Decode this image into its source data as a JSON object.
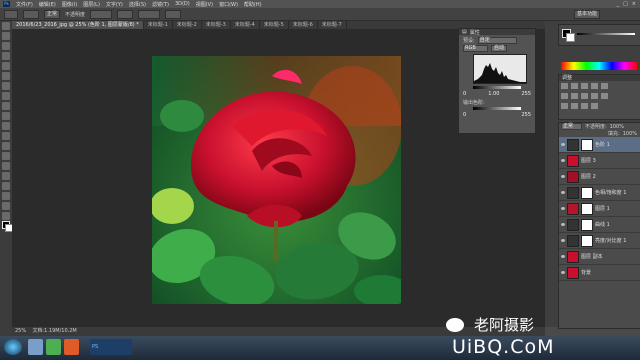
{
  "app": {
    "logo": "Ps",
    "window_controls": [
      "_",
      "□",
      "×"
    ]
  },
  "menu": [
    "文件(F)",
    "编辑(E)",
    "图像(I)",
    "图层(L)",
    "文字(Y)",
    "选择(S)",
    "滤镜(T)",
    "3D(D)",
    "视图(V)",
    "窗口(W)",
    "帮助(H)"
  ],
  "options": {
    "mode_label": "正常",
    "opacity_label": "不透明度",
    "workspace": "基本功能"
  },
  "tabs": [
    {
      "label": "2016/6/23_2016_jpg @ 25% (色阶 1, 图层蒙版/8) *",
      "active": true
    },
    {
      "label": "未标题-1",
      "active": false
    },
    {
      "label": "未标题-2",
      "active": false
    },
    {
      "label": "未标题-3",
      "active": false
    },
    {
      "label": "未标题-4",
      "active": false
    },
    {
      "label": "未标题-5",
      "active": false
    },
    {
      "label": "未标题-6",
      "active": false
    },
    {
      "label": "未标题-7",
      "active": false
    }
  ],
  "levels": {
    "title": "属性",
    "preset_label": "预设:",
    "preset_value": "自定",
    "channel": "RGB",
    "auto_label": "自动",
    "input_black": "0",
    "input_gray": "1.00",
    "input_white": "255",
    "output_label": "输出色阶:",
    "output_black": "0",
    "output_white": "255"
  },
  "adjustments": {
    "title": "调整"
  },
  "layers": {
    "blend_mode": "正常",
    "opacity_label": "不透明度:",
    "opacity_value": "100%",
    "fill_label": "填充:",
    "fill_value": "100%",
    "items": [
      {
        "name": "色阶 1",
        "has_mask": true,
        "selected": true
      },
      {
        "name": "图层 3",
        "has_mask": false,
        "selected": false
      },
      {
        "name": "图层 2",
        "has_mask": false,
        "selected": false
      },
      {
        "name": "色相/饱和度 1",
        "has_mask": true,
        "selected": false
      },
      {
        "name": "图层 1",
        "has_mask": true,
        "selected": false
      },
      {
        "name": "曲线 1",
        "has_mask": true,
        "selected": false
      },
      {
        "name": "亮度/对比度 1",
        "has_mask": true,
        "selected": false
      },
      {
        "name": "图层 副本",
        "has_mask": false,
        "selected": false
      },
      {
        "name": "背景",
        "has_mask": false,
        "selected": false
      }
    ]
  },
  "status": {
    "zoom": "25%",
    "doc": "文档:1.19M/10.2M"
  },
  "taskbar": {
    "active_item": "PS"
  },
  "watermark": {
    "line1": "老阿摄影",
    "line2": "UiBQ.CoM"
  },
  "colors": {
    "rose": "#c8102e",
    "leaf": "#1f7a35",
    "selection": "#5b6e86"
  }
}
